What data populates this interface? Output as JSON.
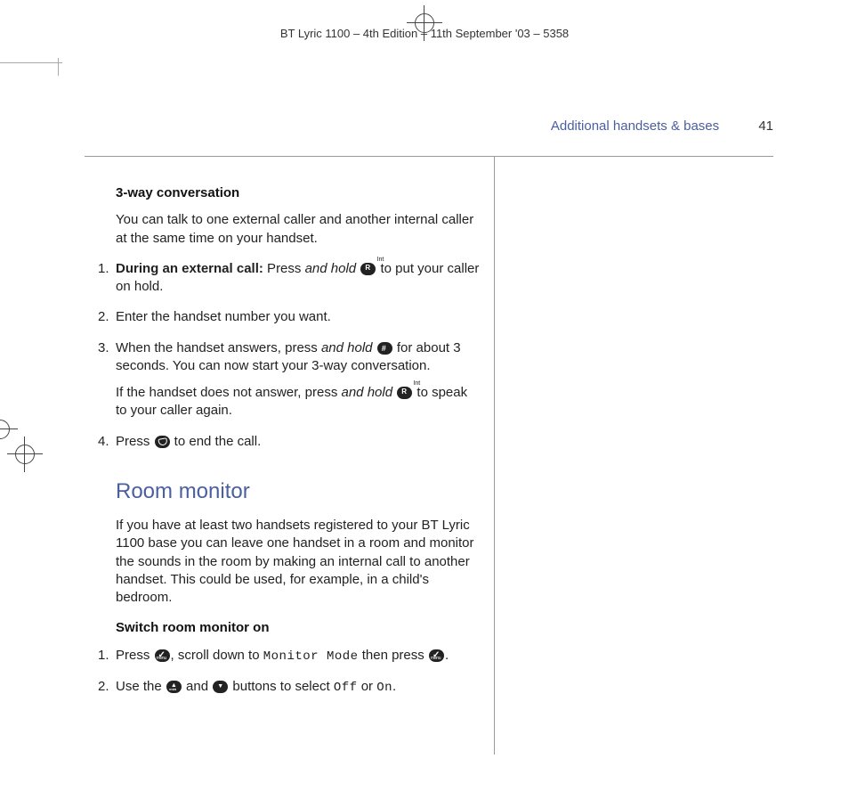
{
  "header": "BT Lyric 1100 – 4th Edition – 11th September '03 – 5358",
  "running": {
    "section": "Additional handsets & bases",
    "page": "41"
  },
  "s1": {
    "title": "3-way conversation",
    "intro": "You can talk to one external caller and another internal caller at the same time on your handset.",
    "step1a": "During an external call:",
    "step1b": " Press ",
    "step1c": "and hold",
    "step1d": " to put your caller on hold.",
    "step2": "Enter the handset number you want.",
    "step3a": "When the handset answers, press ",
    "step3b": "and hold",
    "step3c": " for about 3 seconds. You can now start your 3-way conversation.",
    "step3d": "If the handset does not answer, press ",
    "step3e": "and hold",
    "step3f": " to speak to your caller again.",
    "step4a": "Press ",
    "step4b": " to end the call."
  },
  "s2": {
    "title": "Room monitor",
    "intro": "If you have at least two handsets registered to your BT Lyric 1100 base you can leave one handset in a room and monitor the sounds in the room by making an internal call to another handset. This could be used, for example, in a child's bedroom.",
    "sub": "Switch room monitor on",
    "step1a": "Press ",
    "step1b": ", scroll down to ",
    "step1c": "Monitor Mode",
    "step1d": " then press ",
    "step1e": ".",
    "step2a": "Use the ",
    "step2b": " and ",
    "step2c": " buttons to select ",
    "step2d": "Off",
    "step2e": " or ",
    "step2f": "On",
    "step2g": "."
  }
}
